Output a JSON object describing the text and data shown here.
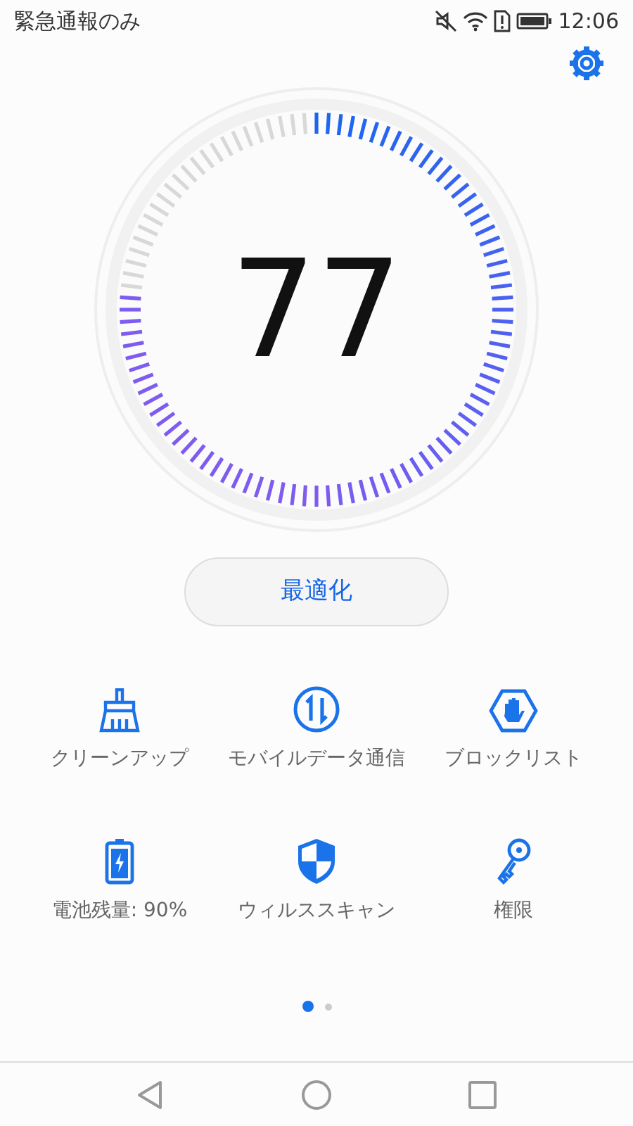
{
  "status_bar": {
    "carrier": "緊急通報のみ",
    "time": "12:06"
  },
  "gauge": {
    "score": "77"
  },
  "optimize_button": "最適化",
  "tools": [
    {
      "label": "クリーンアップ"
    },
    {
      "label": "モバイルデータ通信"
    },
    {
      "label": "ブロックリスト"
    },
    {
      "label": "電池残量: 90%"
    },
    {
      "label": "ウィルススキャン"
    },
    {
      "label": "権限"
    }
  ],
  "pages": [
    {
      "selected": true
    },
    {
      "selected": false
    }
  ]
}
